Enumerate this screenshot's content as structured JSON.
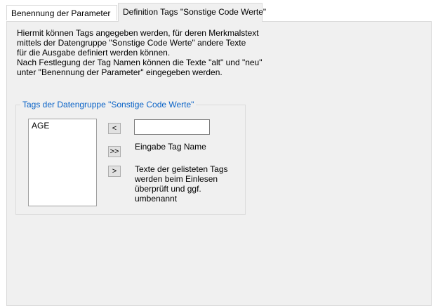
{
  "tabs": {
    "tab1": "Benennung der Parameter",
    "tab2": "Definition Tags \"Sonstige Code Werte\""
  },
  "description": {
    "line1": "Hiermit können Tags angegeben werden, für deren Merkmalstext",
    "line2": "mittels der Datengruppe \"Sonstige Code Werte\" andere Texte",
    "line3": "für die Ausgabe definiert werden können.",
    "line4": "Nach Festlegung der Tag Namen können die Texte \"alt\" und \"neu\"",
    "line5": "unter \"Benennung der Parameter\" eingegeben werden."
  },
  "group": {
    "title": "Tags der Datengruppe \"Sonstige Code Werte\"",
    "list_items": [
      "AGE"
    ],
    "btn_remove": "<",
    "btn_add_all": ">>",
    "btn_add": ">",
    "input_value": "",
    "input_label": "Eingabe Tag Name",
    "note_line1": "Texte der gelisteten Tags",
    "note_line2": "werden beim Einlesen",
    "note_line3": "überprüft und ggf.",
    "note_line4": "umbenannt"
  }
}
